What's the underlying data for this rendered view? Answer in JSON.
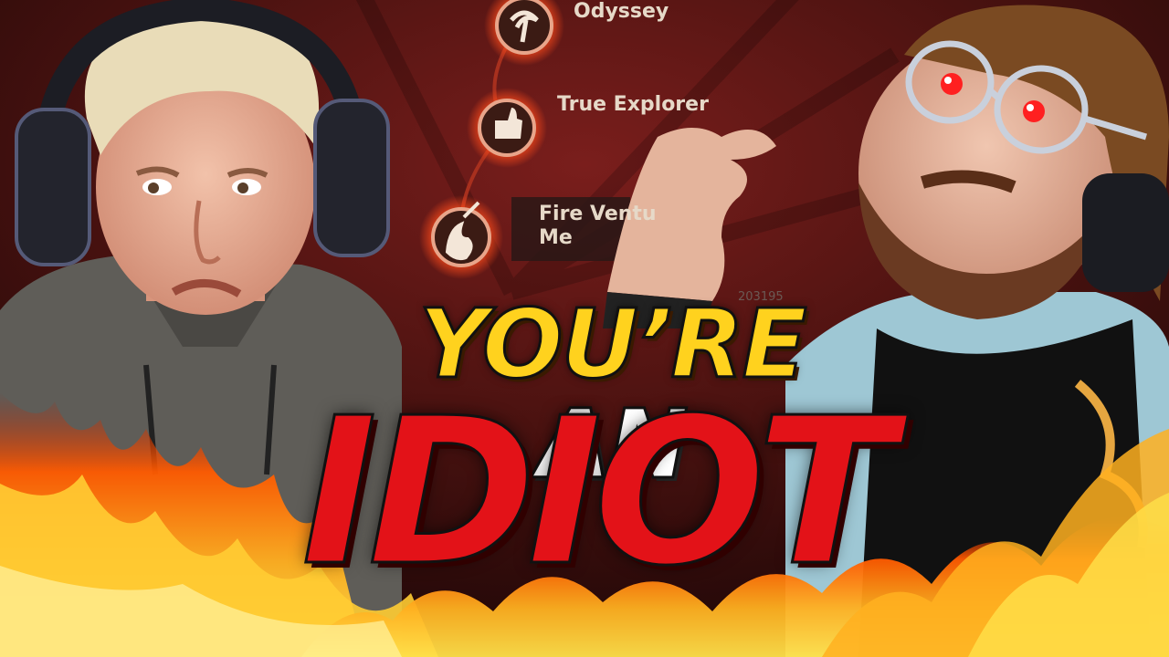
{
  "achievements": [
    {
      "label": "Odyssey",
      "icon": "swirl-medal-icon"
    },
    {
      "label": "True Explorer",
      "icon": "thumbs-up-medal-icon"
    },
    {
      "label": "Fire Ventu\nMe",
      "icon": "sword-flame-medal-icon"
    }
  ],
  "background_number": "203195",
  "headline": {
    "line1_part1": "YOU’RE",
    "line1_part2": "AN",
    "line2": "IDIOT"
  },
  "colors": {
    "background_red": "#5a1414",
    "headline_yellow": "#ffd21e",
    "headline_red": "#e31218",
    "fire_orange": "#ff7a00"
  }
}
